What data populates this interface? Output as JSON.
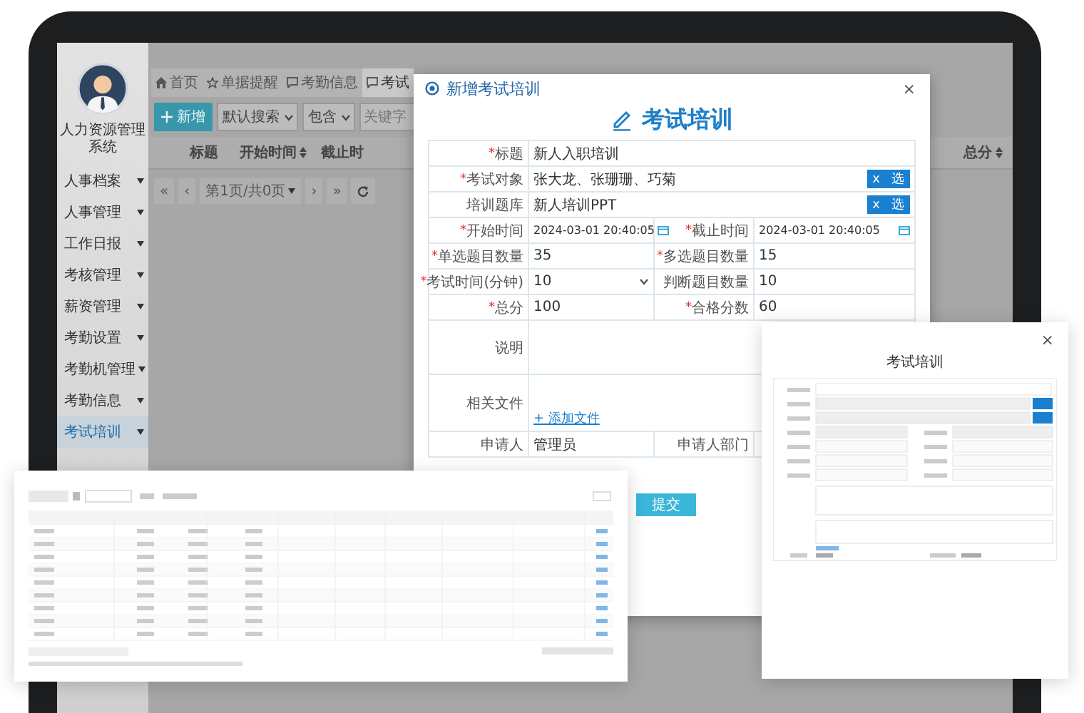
{
  "sidebar": {
    "app_title": "人力资源管理系统",
    "items": [
      {
        "label": "人事档案",
        "selected": false
      },
      {
        "label": "人事管理",
        "selected": false
      },
      {
        "label": "工作日报",
        "selected": false
      },
      {
        "label": "考核管理",
        "selected": false
      },
      {
        "label": "薪资管理",
        "selected": false
      },
      {
        "label": "考勤设置",
        "selected": false
      },
      {
        "label": "考勤机管理",
        "selected": false
      },
      {
        "label": "考勤信息",
        "selected": false
      },
      {
        "label": "考试培训",
        "selected": true
      }
    ]
  },
  "tabs": [
    {
      "label": "首页",
      "kind": "home",
      "selected": false
    },
    {
      "label": "单据提醒",
      "kind": "star",
      "selected": false
    },
    {
      "label": "考勤信息",
      "kind": "chat",
      "selected": false
    },
    {
      "label": "考试",
      "kind": "chat",
      "selected": true
    }
  ],
  "toolbar": {
    "add_button": "新增",
    "search_mode": "默认搜索",
    "match_mode": "包含",
    "keyword_placeholder": "关键字"
  },
  "table": {
    "columns": [
      {
        "label": "标题",
        "sortable": false
      },
      {
        "label": "开始时间",
        "sortable": true
      },
      {
        "label": "截止时",
        "sortable": false
      },
      {
        "label": "总分",
        "sortable": true
      }
    ]
  },
  "pagination": {
    "first": "«",
    "prev": "‹",
    "page": "第1页/共0页",
    "next": "›",
    "last": "»"
  },
  "dialog": {
    "title": "新增考试培训",
    "close": "×",
    "heading": "考试培训",
    "submit": "提交",
    "fields": [
      {
        "label": "标题",
        "required_mark": "*",
        "kind": "text",
        "value": "新人入职培训",
        "wide": true
      },
      {
        "label": "考试对象",
        "required_mark": "*",
        "kind": "picker",
        "value": "张大龙、张珊珊、巧菊",
        "buttons": [
          "x",
          "选"
        ],
        "wide": true
      },
      {
        "label": "培训题库",
        "kind": "picker",
        "value": "新人培训PPT",
        "buttons": [
          "x",
          "选"
        ],
        "wide": true
      },
      {
        "label": "开始时间",
        "required_mark": "*",
        "kind": "date",
        "value": "2024-03-01 20:40:05",
        "wide": false
      },
      {
        "label": "截止时间",
        "required_mark": "*",
        "kind": "date",
        "value": "2024-03-01 20:40:05",
        "wide": false
      },
      {
        "label": "单选题目数量",
        "required_mark": "*",
        "kind": "text",
        "value": "35",
        "wide": false
      },
      {
        "label": "多选题目数量",
        "required_mark": "*",
        "kind": "text",
        "value": "15",
        "wide": false
      },
      {
        "label": "考试时间(分钟)",
        "required_mark": "*",
        "kind": "select",
        "value": "10",
        "wide": false
      },
      {
        "label": "判断题目数量",
        "kind": "text",
        "value": "10",
        "wide": false
      },
      {
        "label": "总分",
        "required_mark": "*",
        "kind": "text",
        "value": "100",
        "wide": false
      },
      {
        "label": "合格分数",
        "required_mark": "*",
        "kind": "text",
        "value": "60",
        "wide": false
      },
      {
        "label": "说明",
        "kind": "textarea",
        "wide": true
      },
      {
        "label": "相关文件",
        "kind": "file",
        "link": "+ 添加文件",
        "wide": true
      },
      {
        "label": "申请人",
        "kind": "static",
        "value": "管理员",
        "wide": false
      },
      {
        "label": "申请人部门",
        "kind": "static",
        "wide": false
      }
    ]
  },
  "preview_form": {
    "heading": "考试培训",
    "close": "×"
  }
}
